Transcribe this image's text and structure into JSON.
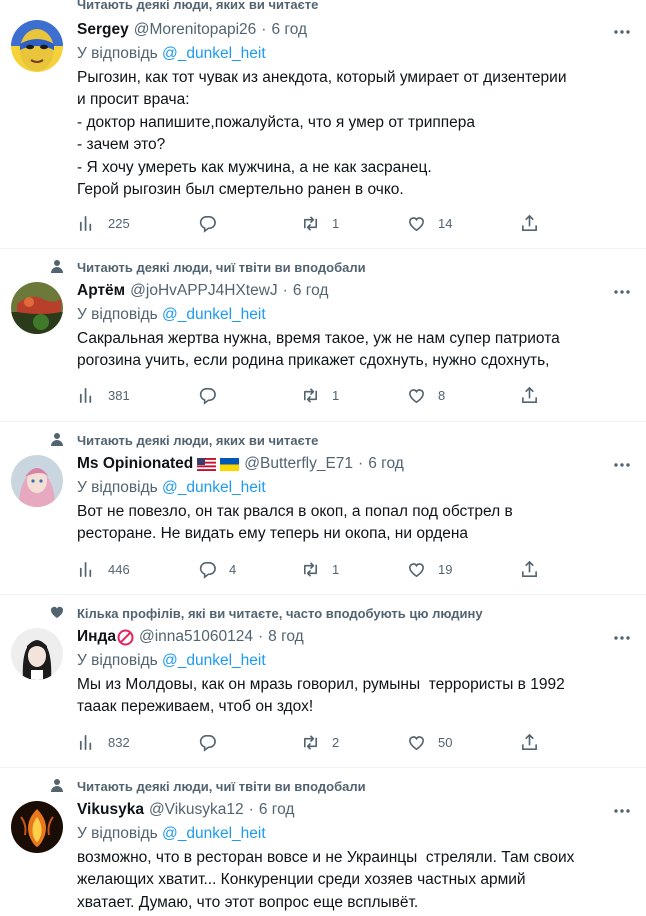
{
  "tweets": [
    {
      "social": "Читають деякі люди, яких ви читаєте",
      "name": "Sergey",
      "handle": "@Morenitopapi26",
      "time": "6 год",
      "reply_prefix": "У відповідь",
      "reply_user": "@_dunkel_heit",
      "text": "Рыгозин, как тот чувак из анекдота, который умирает от дизентерии\nи просит врача:\n- доктор напишите,пожалуйста, что я умер от триппера\n- зачем это?\n- Я хочу умереть как мужчина, а не как засранец.\nГерой рыгозин был смертельно ранен в очко.",
      "views": "225",
      "replies": "",
      "retweets": "1",
      "likes": "14"
    },
    {
      "social": "Читають деякі люди, чиї твіти ви вподобали",
      "name": "Артём",
      "handle": "@joHvAPPJ4HXtewJ",
      "time": "6 год",
      "reply_prefix": "У відповідь",
      "reply_user": "@_dunkel_heit",
      "text": "Сакральная жертва нужна, время такое, уж не нам супер патриота\nрогозина учить, если родина прикажет сдохнуть, нужно сдохнуть,",
      "views": "381",
      "replies": "",
      "retweets": "1",
      "likes": "8"
    },
    {
      "social": "Читають деякі люди, яких ви читаєте",
      "name": "Ms Opinionated",
      "handle": "@Butterfly_E71",
      "time": "6 год",
      "reply_prefix": "У відповідь",
      "reply_user": "@_dunkel_heit",
      "text": "Вот не повезло, он так рвался в окоп, а попал под обстрел в\nресторане. Не видать ему теперь ни окопа, ни ордена",
      "views": "446",
      "replies": "4",
      "retweets": "1",
      "likes": "19"
    },
    {
      "social": "Кілька профілів, які ви читаєте, часто вподобують цю людину",
      "name": "Инда",
      "handle": "@inna51060124",
      "time": "8 год",
      "reply_prefix": "У відповідь",
      "reply_user": "@_dunkel_heit",
      "text": "Мы из Молдовы, как он мразь говорил, румыны  террористы в 1992\nтааак переживаем, чтоб он здох!",
      "views": "832",
      "replies": "",
      "retweets": "2",
      "likes": "50"
    },
    {
      "social": "Читають деякі люди, чиї твіти ви вподобали",
      "name": "Vikusyka",
      "handle": "@Vikusyka12",
      "time": "6 год",
      "reply_prefix": "У відповідь",
      "reply_user": "@_dunkel_heit",
      "text": "возможно, что в ресторан вовсе и не Украинцы  стреляли. Там своих\nжелающих хватит... Конкуренции среди хозяев частных армий\nхватает. Думаю, что этот вопрос еще всплывёт.",
      "views": "",
      "replies": "",
      "retweets": "",
      "likes": ""
    }
  ],
  "colors": {
    "link": "#1d9bf0",
    "secondary": "#536471",
    "text": "#0f1419",
    "divider": "#eff3f4"
  },
  "icons": [
    "person-icon",
    "more-icon",
    "views-icon",
    "reply-icon",
    "retweet-icon",
    "like-icon",
    "share-icon",
    "us-flag-icon",
    "ukraine-flag-icon",
    "no-entry-icon"
  ]
}
